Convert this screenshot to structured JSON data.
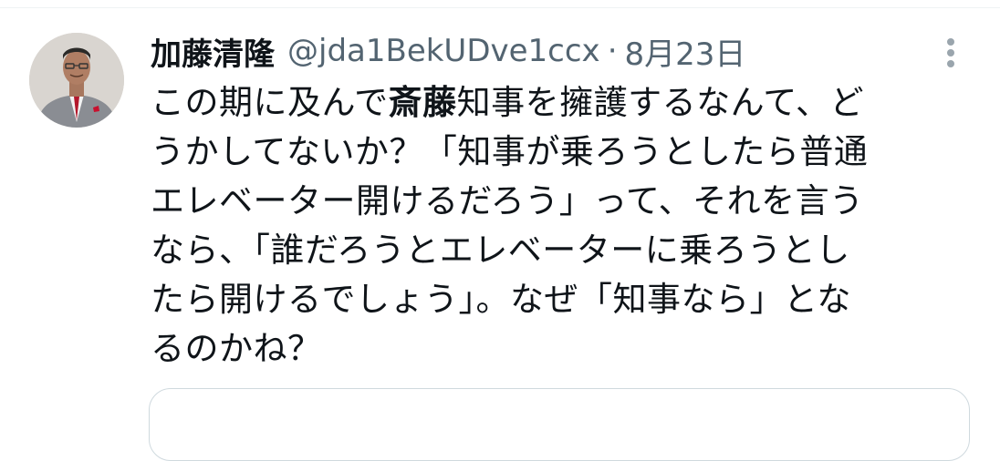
{
  "tweet": {
    "author": {
      "display_name": "加藤清隆",
      "handle": "@jda1BekUDve1ccx"
    },
    "separator": "·",
    "date": "8月23日",
    "more_icon": "more-vertical-icon",
    "lines": [
      {
        "pre": "この期に及んで",
        "bold": "斎藤",
        "post": "知事を擁護するなんて、ど"
      },
      {
        "pre": "うかしてないか？「知事が乗ろうとしたら普通",
        "bold": "",
        "post": ""
      },
      {
        "pre": "エレベーター開けるだろう」って、それを言う",
        "bold": "",
        "post": ""
      },
      {
        "pre": "なら、「誰だろうとエレベーターに乗ろうとし",
        "bold": "",
        "post": ""
      },
      {
        "pre": "たら開けるでしょう」。なぜ「知事なら」とな",
        "bold": "",
        "post": ""
      },
      {
        "pre": "るのかね？",
        "bold": "",
        "post": ""
      }
    ]
  },
  "colors": {
    "text": "#0f1419",
    "secondary": "#536471",
    "border": "#cfd9de"
  }
}
